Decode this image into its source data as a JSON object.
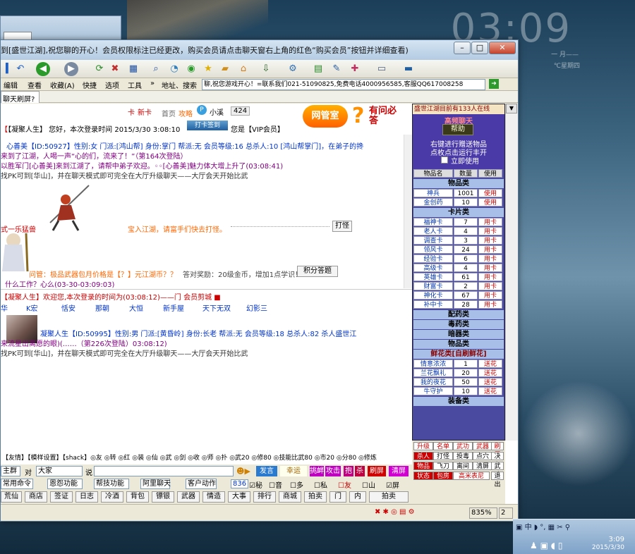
{
  "desktop": {
    "clock": "03:09",
    "clock_sub1": "一 月——",
    "clock_sub2": "℃星期四"
  },
  "window": {
    "title": "到[盛世江湖],祝您聊的开心！会员权限标注已经更改，购买会员请点击聊天窗右上角的红色“购买会员”按钮并详细查看)",
    "minimize": "–",
    "maximize": "□",
    "close": "✕"
  },
  "menu": {
    "items": [
      "编辑",
      "查看",
      "收藏(A)",
      "快捷",
      "选项",
      "工具"
    ],
    "more": "»",
    "addr_label": "地址、搜索",
    "addr_value": "聊,祝您游戏开心！=联系我们021-51090825,免费电话4000956585,客服QQ617008258"
  },
  "tabs": {
    "tab1": "聊天刷屏?"
  },
  "topbar": {
    "labels": [
      "卡",
      "新卡",
      "首页",
      "攻略",
      "小溪",
      "424"
    ],
    "status_line": "【凝聚人生】 您好，本次登录时间 2015/3/30 3:08:10",
    "card_btn": "打卡签到",
    "vip": "您是【VIP会员】",
    "banner1": "网管室",
    "banner2": "有问必答"
  },
  "chat_top": {
    "line1": "心善美【ID:50927】性别:女 门派:[鸿山帮] 身份:掌门 帮派:无 会员等级:16 总杀人:10 [鸿山帮掌门]，在弟子的搀",
    "line2": "来到了江湖，人喝一声“心的们，流来了！”（第164次登陆）",
    "line3": "以胜军门[心善美]来到江湖了，请帮中弟子欢迎。◦◦[心善美]魅力体大增上升了(03:08:41)",
    "line4": "找PK可到[华山]，并在聊天模式即可完全在大厅升级聊天——大厅会天开始比武",
    "line5": "式一乐猛兽",
    "line6": "宝入江湖，请富手们快去打怪。",
    "line6_btn": "打怪",
    "line7": "问管：极品武器包月价格是【？】元江湖币？？",
    "line7b": "答对奖励：20级金币，增加1点学识！",
    "line7_btn": "积分答题",
    "line8": "什么工作？心么(03-30-03:09:03)"
  },
  "chat_bottom": {
    "line1": "【凝聚人生】欢迎您,本次登录的时间为(03:08:12)——门 会员剪城 ■",
    "users": [
      "华",
      "K宏",
      "恬安",
      "那朝",
      "大恒",
      "新手屋",
      "天下无双",
      "幻影三"
    ],
    "line2": "凝聚人生【ID:50995】性别:男 门派:[黄昏岭] 身份:长老 帮派:无 会员等级:18 总杀人:82 杀人盛世江",
    "line3": "来流星出离愿的眼)(……（第226次登陆）03:08:12)",
    "line4": "找PK可到[华山]，并在聊天模式即可完全在大厅升级聊天——大厅会天开始比武"
  },
  "rpanel": {
    "head": "盛世江湖目前有133人在线",
    "top1": "高频聊天",
    "help": "帮助",
    "top2": "右键进行赠送物品",
    "top3": "点枚点击运行丰开",
    "top4": "立即使用",
    "cols": [
      "物品名",
      "数量",
      "使用"
    ],
    "sec_items": "物品类",
    "items": [
      [
        "神兵",
        "1001",
        "使用"
      ],
      [
        "金创药",
        "10",
        "使用"
      ]
    ],
    "sec_cards": "卡片类",
    "cards": [
      [
        "福神卡",
        "7",
        "用卡"
      ],
      [
        "老人卡",
        "4",
        "用卡"
      ],
      [
        "调查卡",
        "3",
        "用卡"
      ],
      [
        "领风卡",
        "24",
        "用卡"
      ],
      [
        "经验卡",
        "6",
        "用卡"
      ],
      [
        "高级卡",
        "4",
        "用卡"
      ],
      [
        "英雄卡",
        "61",
        "用卡"
      ],
      [
        "财富卡",
        "2",
        "用卡"
      ],
      [
        "神化卡",
        "67",
        "用卡"
      ],
      [
        "补中卡",
        "28",
        "用卡"
      ]
    ],
    "sec_food": "配药类",
    "sec_drug": "毒药类",
    "sec_hidden": "暗器类",
    "sec_goods": "物品类",
    "sec_flower": "鲜花类[自刷鲜花]",
    "flowers": [
      [
        "情意浓浓",
        "1",
        "送花"
      ],
      [
        "兰花飘礼",
        "20",
        "送花"
      ],
      [
        "我的夜花",
        "50",
        "送花"
      ],
      [
        "牛守护",
        "10",
        "送花"
      ]
    ],
    "sec_equip": "装备类"
  },
  "bottom_tools": "【友情】【模样设置】【shack】◎友 ◎转 ◎红 ◎装 ◎仙 ◎武 ◎剑 ◎收 ◎师 ◎扑 ◎武20 ◎修80 ◎技能比武80 ◎市20 ◎分80 ◎修炼",
  "input": {
    "target": "主群",
    "to": "对",
    "who": "大家",
    "say": "说",
    "send": "发言",
    "buttons": [
      "幸运",
      "挑衅",
      "攻击",
      "抱",
      "杀",
      "刷屏",
      "清屏"
    ]
  },
  "options": {
    "sel1": "常用命令",
    "sel2": "恩怨功能",
    "sel3": "帮技功能",
    "sel4": "阿里聊天",
    "sel5": "客户动作",
    "num": "836",
    "checks": [
      "秘",
      "音",
      "多",
      "私",
      "友",
      "山",
      "屏"
    ]
  },
  "actions": [
    "荒仙",
    "商店",
    "签证",
    "日志",
    "冷酒",
    "背包",
    "镖银",
    "武器",
    "情造",
    "大事",
    "排行",
    "商城",
    "拍卖",
    "门",
    "内",
    "拍卖"
  ],
  "cmds": [
    "升级",
    "名单",
    "武功",
    "武器",
    "刷屏",
    "杀人",
    "打怪",
    "投毒",
    "点穴",
    "决心",
    "物品",
    "飞刀",
    "离间",
    "清屏",
    "武功",
    "状态",
    "包房",
    "高米表尼",
    "退出"
  ],
  "status": {
    "zoom": "835%",
    "count": "2"
  },
  "tray": {
    "time": "3:09",
    "date": "2015/3/30"
  }
}
